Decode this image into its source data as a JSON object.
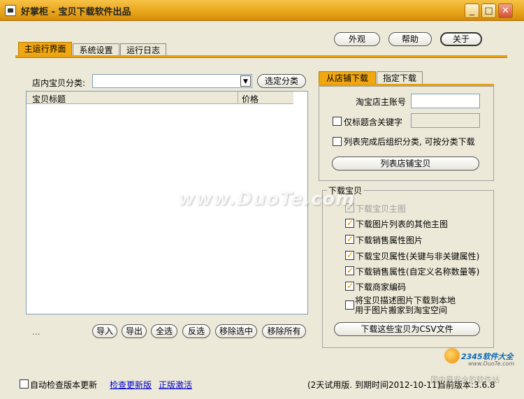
{
  "window": {
    "title": "好掌柜 - 宝贝下载软件出品",
    "controls": {
      "minimize": "_",
      "maximize": "□",
      "close": "✕"
    }
  },
  "top_buttons": {
    "appearance": "外观",
    "help": "帮助",
    "about": "关于"
  },
  "main_tabs": [
    {
      "label": "主运行界面",
      "active": true
    },
    {
      "label": "系统设置",
      "active": false
    },
    {
      "label": "运行日志",
      "active": false
    }
  ],
  "category": {
    "label": "店内宝贝分类:",
    "value": "",
    "select_button": "选定分类"
  },
  "item_list": {
    "columns": [
      "宝贝标题",
      "价格"
    ],
    "rows": []
  },
  "list_buttons": [
    "导入",
    "导出",
    "全选",
    "反选",
    "移除选中",
    "移除所有"
  ],
  "list_status": "...",
  "right_tabs": [
    {
      "label": "从店铺下载",
      "active": true
    },
    {
      "label": "指定下载",
      "active": false
    }
  ],
  "shop_form": {
    "account_label": "淘宝店主账号",
    "account_value": "",
    "keyword_checkbox": {
      "label": "仅标题含关键字",
      "checked": false
    },
    "keyword_value": "",
    "organize_checkbox": {
      "label": "列表完成后组织分类, 可按分类下载",
      "checked": false
    },
    "list_button": "列表店铺宝贝"
  },
  "download_group": {
    "title": "下载宝贝",
    "options": [
      {
        "label": "下载宝贝主图",
        "checked": true,
        "disabled": true
      },
      {
        "label": "下载图片列表的其他主图",
        "checked": true,
        "disabled": false
      },
      {
        "label": "下载销售属性图片",
        "checked": true,
        "disabled": false
      },
      {
        "label": "下载宝贝属性(关键与非关键属性)",
        "checked": true,
        "disabled": false
      },
      {
        "label": "下载销售属性(自定义名称数量等)",
        "checked": true,
        "disabled": false
      },
      {
        "label": "下载商家编码",
        "checked": true,
        "disabled": false
      }
    ],
    "desc_option": {
      "line1": "将宝贝描述图片下载到本地",
      "line2": "用于图片搬家到淘宝空间",
      "checked": false
    },
    "csv_button": "下载这些宝贝为CSV文件"
  },
  "footer": {
    "auto_update_label": "自动检查版本更新",
    "auto_update_checked": false,
    "check_update_link": "检查更新版",
    "activate_link": "正版激活",
    "trial_text": "(2天试用版. 到期时间2012-10-11)",
    "version_text": "当前版本:3.6.8"
  },
  "watermark": {
    "main": "www.DuoTe.com",
    "corner_brand": "2345软件大全",
    "corner_site": "www.DuoTe.com",
    "corner_slogan": "国内最安全的软件站"
  }
}
